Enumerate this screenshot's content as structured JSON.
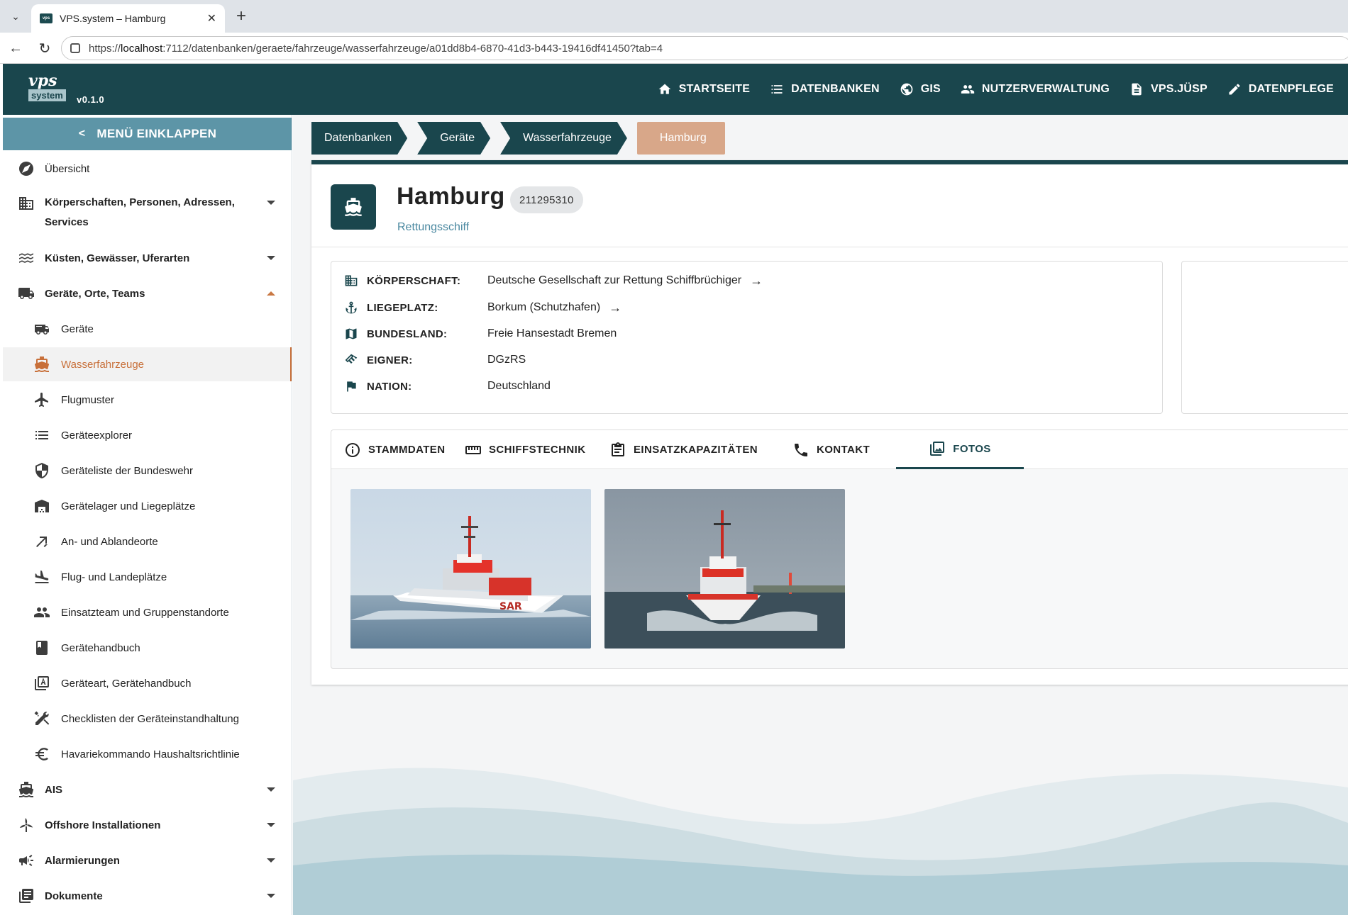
{
  "browser": {
    "tab_title": "VPS.system – Hamburg",
    "url_prefix": "https://",
    "url_host": "localhost",
    "url_rest": ":7112/datenbanken/geraete/fahrzeuge/wasserfahrzeuge/a01dd8b4-6870-41d3-b443-19416df41450?tab=4"
  },
  "header": {
    "logo_top": "vps",
    "logo_bottom": "system",
    "version": "v0.1.0",
    "nav": [
      {
        "label": "STARTSEITE",
        "icon": "home-icon"
      },
      {
        "label": "DATENBANKEN",
        "icon": "list-icon"
      },
      {
        "label": "GIS",
        "icon": "globe-icon"
      },
      {
        "label": "NUTZERVERWALTUNG",
        "icon": "users-icon"
      },
      {
        "label": "VPS.JÜSP",
        "icon": "document-icon"
      },
      {
        "label": "DATENPFLEGE",
        "icon": "pencil-icon"
      }
    ]
  },
  "sidebar": {
    "collapse_label": "MENÜ EINKLAPPEN",
    "items": [
      {
        "label": "Übersicht",
        "icon": "compass-icon"
      },
      {
        "label_line1": "Körperschaften, Personen, Adressen,",
        "label_line2": "Services",
        "icon": "building-icon"
      },
      {
        "label": "Küsten, Gewässer, Uferarten",
        "icon": "waves-icon"
      },
      {
        "label": "Geräte, Orte, Teams",
        "icon": "truck-icon"
      },
      {
        "label": "Geräte",
        "icon": "fire-truck-icon"
      },
      {
        "label": "Wasserfahrzeuge",
        "icon": "ship-icon"
      },
      {
        "label": "Flugmuster",
        "icon": "airplane-icon"
      },
      {
        "label": "Geräteexplorer",
        "icon": "list-icon"
      },
      {
        "label": "Geräteliste der Bundeswehr",
        "icon": "shield-icon"
      },
      {
        "label": "Gerätelager und Liegeplätze",
        "icon": "warehouse-icon"
      },
      {
        "label": "An- und Ablandeorte",
        "icon": "arrows-icon"
      },
      {
        "label": "Flug- und Landeplätze",
        "icon": "landing-icon"
      },
      {
        "label": "Einsatzteam und Gruppenstandorte",
        "icon": "group-icon"
      },
      {
        "label": "Gerätehandbuch",
        "icon": "book-icon"
      },
      {
        "label": "Geräteart, Gerätehandbuch",
        "icon": "font-box-icon"
      },
      {
        "label": "Checklisten der Geräteinstandhaltung",
        "icon": "tools-icon"
      },
      {
        "label": "Havariekommando Haushaltsrichtlinie",
        "icon": "euro-icon"
      },
      {
        "label": "AIS",
        "icon": "ship-icon"
      },
      {
        "label": "Offshore Installationen",
        "icon": "wind-turbine-icon"
      },
      {
        "label": "Alarmierungen",
        "icon": "megaphone-icon"
      },
      {
        "label": "Dokumente",
        "icon": "documents-icon"
      }
    ]
  },
  "breadcrumb": [
    "Datenbanken",
    "Geräte",
    "Wasserfahrzeuge",
    "Hamburg"
  ],
  "vessel": {
    "title": "Hamburg",
    "badge": "211295310",
    "subtitle": "Rettungsschiff"
  },
  "info": [
    {
      "label": "KÖRPERSCHAFT:",
      "value": "Deutsche Gesellschaft zur Rettung Schiffbrüchiger",
      "icon": "building-icon",
      "link": true
    },
    {
      "label": "LIEGEPLATZ:",
      "value": "Borkum (Schutzhafen)",
      "icon": "anchor-icon",
      "link": true
    },
    {
      "label": "BUNDESLAND:",
      "value": "Freie Hansestadt Bremen",
      "icon": "map-icon",
      "link": false
    },
    {
      "label": "EIGNER:",
      "value": "DGzRS",
      "icon": "handshake-icon",
      "link": false
    },
    {
      "label": "NATION:",
      "value": "Deutschland",
      "icon": "flag-icon",
      "link": false
    }
  ],
  "arrow_glyph": "→",
  "tabs": [
    {
      "label": "STAMMDATEN",
      "icon": "info-icon"
    },
    {
      "label": "SCHIFFSTECHNIK",
      "icon": "ruler-icon"
    },
    {
      "label": "EINSATZKAPAZITÄTEN",
      "icon": "clipboard-icon"
    },
    {
      "label": "KONTAKT",
      "icon": "phone-icon"
    },
    {
      "label": "FOTOS",
      "icon": "photo-library-icon",
      "active": true
    }
  ],
  "colors": {
    "primary": "#1a464d",
    "accent": "#c8703a",
    "collapse": "#5d95a7",
    "breadcrumb_current": "#d8a789"
  }
}
